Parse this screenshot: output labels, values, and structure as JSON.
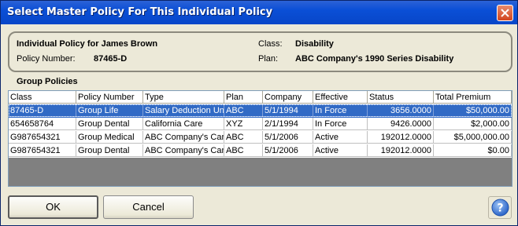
{
  "window": {
    "title": "Select Master Policy For This Individual Policy"
  },
  "info": {
    "heading": "Individual Policy for James Brown",
    "policy_number_label": "Policy Number:",
    "policy_number": "87465-D",
    "class_label": "Class:",
    "class_value": "Disability",
    "plan_label": "Plan:",
    "plan_value": "ABC Company's 1990 Series Disability"
  },
  "group_policies": {
    "label": "Group Policies",
    "columns": [
      "Class",
      "Policy Number",
      "Type",
      "Plan",
      "Company",
      "Effective",
      "Status",
      "Total Premium"
    ],
    "rows": [
      [
        "87465-D",
        "Group Life",
        "Salary Deduction Un",
        "ABC",
        "5/1/1994",
        "In Force",
        "3656.0000",
        "$50,000.00"
      ],
      [
        "654658764",
        "Group Dental",
        "California Care",
        "XYZ",
        "2/1/1994",
        "In Force",
        "9426.0000",
        "$2,000.00"
      ],
      [
        "G987654321",
        "Group Medical",
        "ABC Company's Car",
        "ABC",
        "5/1/2006",
        "Active",
        "192012.0000",
        "$5,000,000.00"
      ],
      [
        "G987654321",
        "Group Dental",
        "ABC Company's Car",
        "ABC",
        "5/1/2006",
        "Active",
        "192012.0000",
        "$0.00"
      ]
    ],
    "selected_row": 0
  },
  "buttons": {
    "ok": "OK",
    "cancel": "Cancel"
  },
  "icons": {
    "close": "close-icon",
    "help": "help-icon"
  },
  "colors": {
    "titlebar": "#0846c8",
    "selection": "#316ac5",
    "dialog_bg": "#ece9d8"
  }
}
